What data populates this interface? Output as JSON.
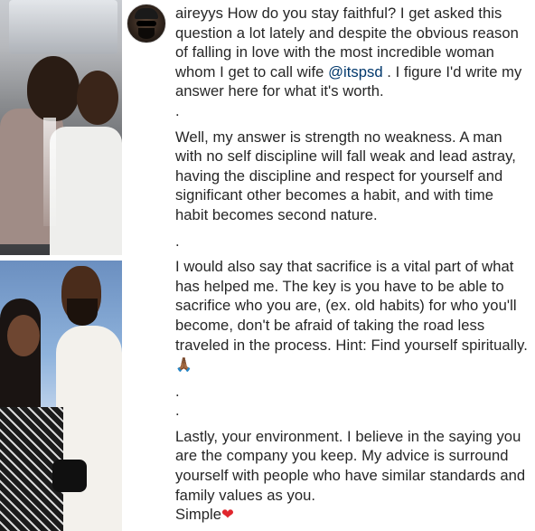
{
  "post": {
    "username": "aireyys",
    "caption": {
      "intro": "How do you stay faithful? I get asked this question a lot lately and despite the obvious reason of falling in love with the most incredible woman whom I get to call wife ",
      "mention": "@itspsd",
      "intro_end": " . I figure I'd write my answer here for what it's worth.",
      "dot": ".",
      "para1": "Well, my answer is strength no weakness. A man with no self discipline will fall weak and lead astray, having the discipline and respect for yourself and significant other becomes a habit, and with time habit becomes second nature.",
      "para2": "I would also say that sacrifice is a vital part of what has helped me. The key is you have to be able to sacrifice who you are, (ex. old habits) for who you'll become, don't be afraid of taking the road less traveled in the process. Hint: Find yourself spiritually.",
      "pray_emoji": "🙏🏾",
      "para3": "Lastly, your environment. I believe in the saying you are the company you keep. My advice is surround yourself with people who have similar standards and family values as you.",
      "closing": "Simple",
      "heart_emoji": "❤"
    }
  },
  "icons": {
    "avatar": "profile-avatar",
    "heart": "heart-icon",
    "pray": "praying-hands-icon"
  },
  "colors": {
    "text": "#262626",
    "mention": "#00376b",
    "heart": "#e0262d"
  }
}
